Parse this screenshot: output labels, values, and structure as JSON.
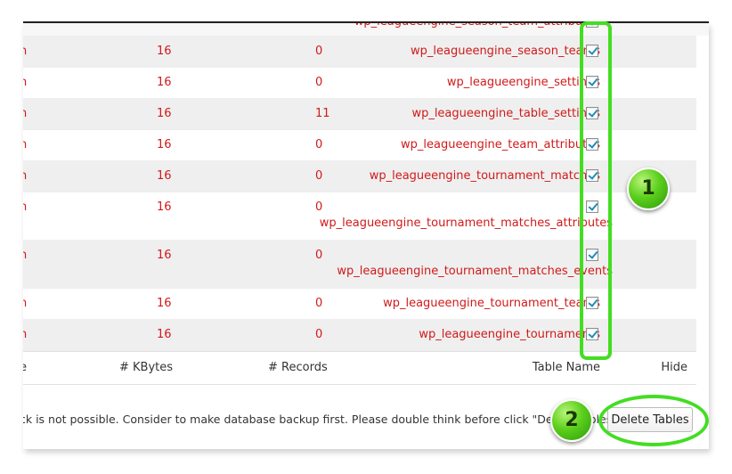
{
  "table": {
    "partial_top_name": "wp_leagueengine_season_team_attributes",
    "rows": [
      {
        "kbytes": "16",
        "records": "0",
        "name": "wp_leagueengine_season_teams"
      },
      {
        "kbytes": "16",
        "records": "0",
        "name": "wp_leagueengine_settings"
      },
      {
        "kbytes": "16",
        "records": "11",
        "name": "wp_leagueengine_table_settings"
      },
      {
        "kbytes": "16",
        "records": "0",
        "name": "wp_leagueengine_team_attributes"
      },
      {
        "kbytes": "16",
        "records": "0",
        "name": "wp_leagueengine_tournament_matches"
      },
      {
        "kbytes": "16",
        "records": "0",
        "name": "wp_leagueengine_tournament_matches_attributes"
      },
      {
        "kbytes": "16",
        "records": "0",
        "name": "wp_leagueengine_tournament_matches_events"
      },
      {
        "kbytes": "16",
        "records": "0",
        "name": "wp_leagueengine_tournament_teams"
      },
      {
        "kbytes": "16",
        "records": "0",
        "name": "wp_leagueengine_tournaments"
      }
    ],
    "first_col_glyph": "n",
    "header": {
      "first": "e",
      "kbytes": "# KBytes",
      "records": "# Records",
      "name": "Table Name",
      "hide": "Hide"
    }
  },
  "footer": {
    "warning_text": "ck is not possible. Consider to make database backup first. Please double think before click \"Delete Tables\" button",
    "delete_button_label": "Delete Tables"
  },
  "annotations": {
    "badge1": "1",
    "badge2": "2",
    "highlight_color": "#44dd22"
  }
}
